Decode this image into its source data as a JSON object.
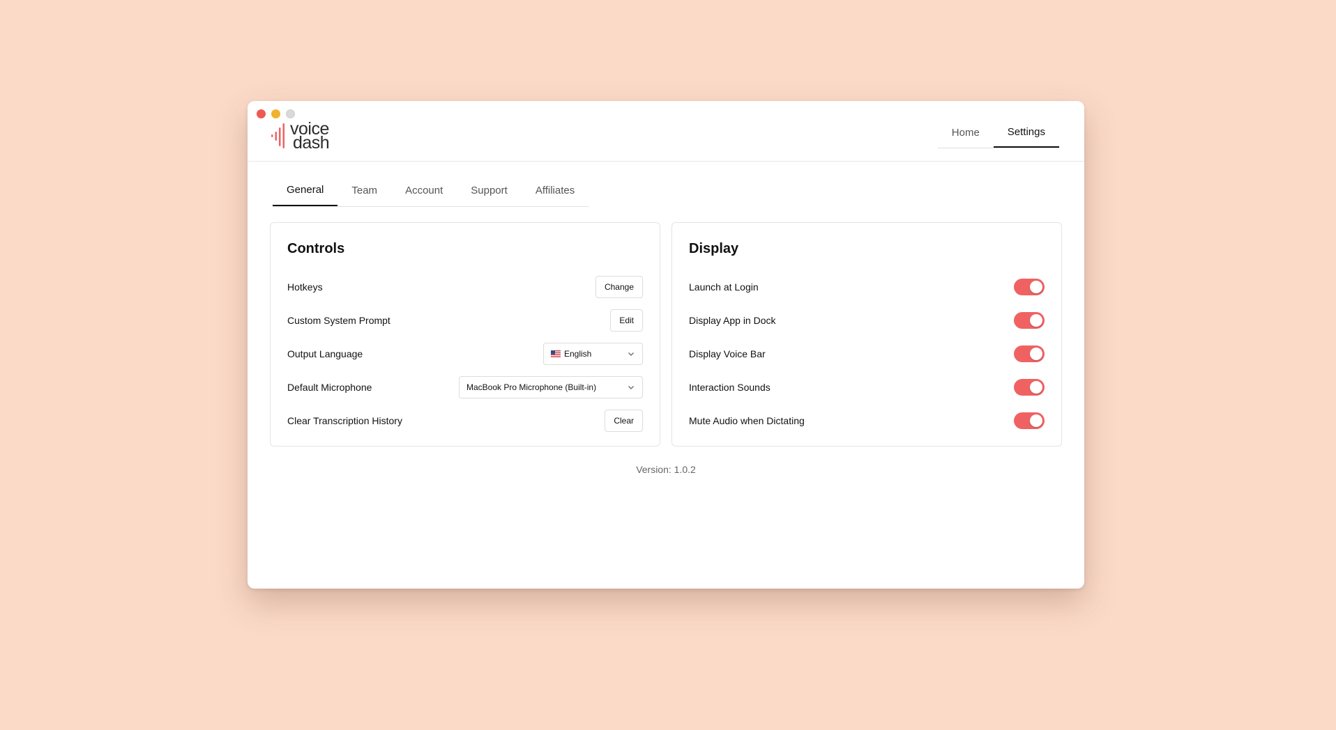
{
  "app": {
    "logo_line1": "voice",
    "logo_line2": "dash",
    "accent_color": "#f06262"
  },
  "topnav": {
    "tabs": [
      {
        "label": "Home",
        "active": false
      },
      {
        "label": "Settings",
        "active": true
      }
    ]
  },
  "subtabs": {
    "tabs": [
      {
        "label": "General",
        "active": true
      },
      {
        "label": "Team",
        "active": false
      },
      {
        "label": "Account",
        "active": false
      },
      {
        "label": "Support",
        "active": false
      },
      {
        "label": "Affiliates",
        "active": false
      }
    ]
  },
  "controls": {
    "title": "Controls",
    "hotkeys": {
      "label": "Hotkeys",
      "button": "Change"
    },
    "prompt": {
      "label": "Custom System Prompt",
      "button": "Edit"
    },
    "language": {
      "label": "Output Language",
      "value": "English",
      "flag_icon": "us-flag-icon"
    },
    "microphone": {
      "label": "Default Microphone",
      "value": "MacBook Pro Microphone (Built-in)"
    },
    "history": {
      "label": "Clear Transcription History",
      "button": "Clear"
    }
  },
  "display": {
    "title": "Display",
    "items": [
      {
        "label": "Launch at Login",
        "on": true
      },
      {
        "label": "Display App in Dock",
        "on": true
      },
      {
        "label": "Display Voice Bar",
        "on": true
      },
      {
        "label": "Interaction Sounds",
        "on": true
      },
      {
        "label": "Mute Audio when Dictating",
        "on": true
      }
    ]
  },
  "footer": {
    "version": "Version: 1.0.2"
  }
}
